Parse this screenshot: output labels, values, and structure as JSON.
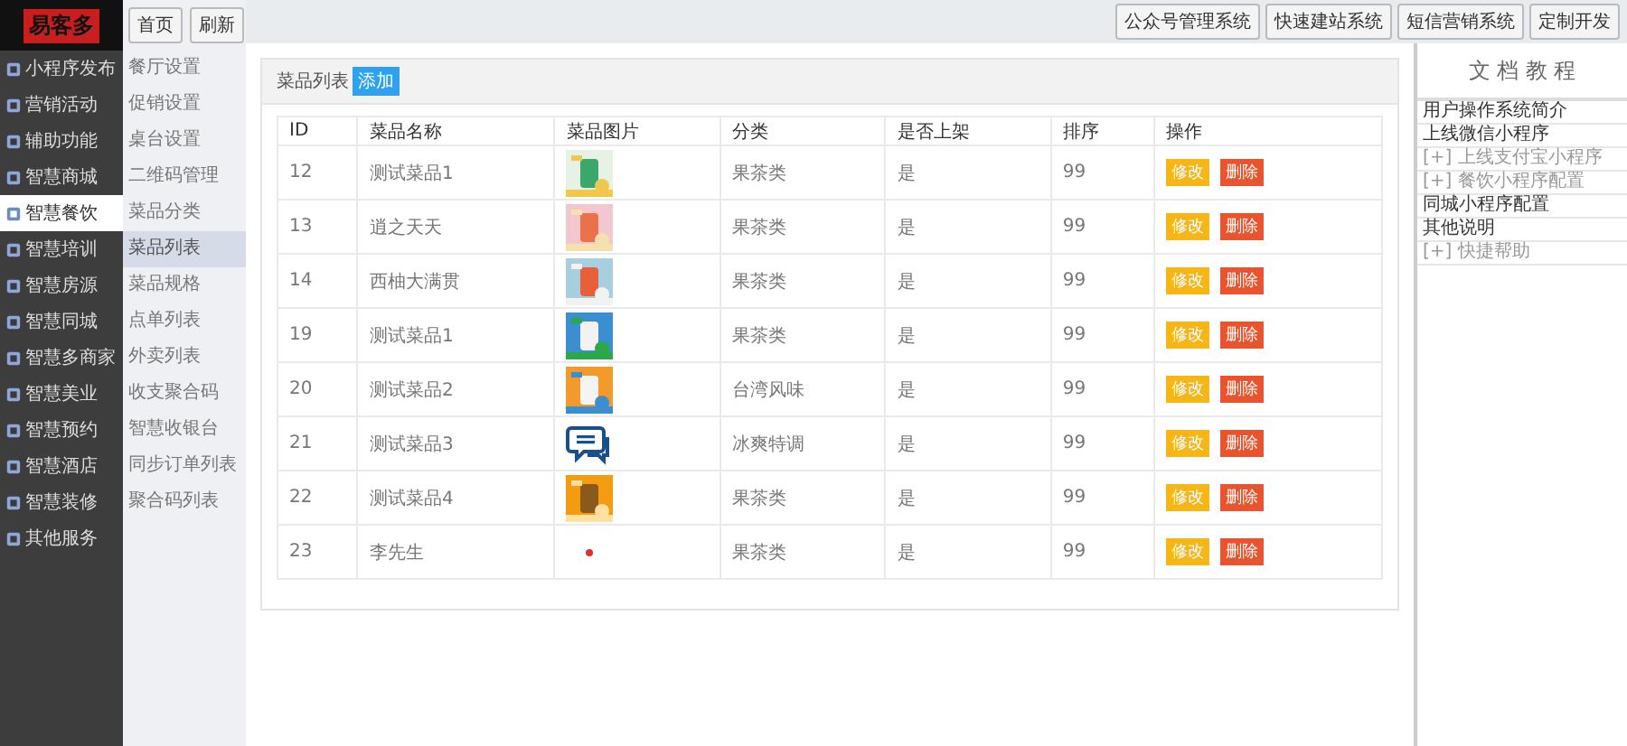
{
  "logo": "易客多",
  "top_buttons": [
    "首页",
    "刷新"
  ],
  "top_links": [
    "公众号管理系统",
    "快速建站系统",
    "短信营销系统",
    "定制开发"
  ],
  "sidebar": {
    "items": [
      {
        "label": "小程序发布",
        "selected": false
      },
      {
        "label": "营销活动",
        "selected": false
      },
      {
        "label": "辅助功能",
        "selected": false
      },
      {
        "label": "智慧商城",
        "selected": false
      },
      {
        "label": "智慧餐饮",
        "selected": true
      },
      {
        "label": "智慧培训",
        "selected": false
      },
      {
        "label": "智慧房源",
        "selected": false
      },
      {
        "label": "智慧同城",
        "selected": false
      },
      {
        "label": "智慧多商家",
        "selected": false
      },
      {
        "label": "智慧美业",
        "selected": false
      },
      {
        "label": "智慧预约",
        "selected": false
      },
      {
        "label": "智慧酒店",
        "selected": false
      },
      {
        "label": "智慧装修",
        "selected": false
      },
      {
        "label": "其他服务",
        "selected": false
      }
    ]
  },
  "submenu": {
    "items": [
      {
        "label": "餐厅设置",
        "selected": false
      },
      {
        "label": "促销设置",
        "selected": false
      },
      {
        "label": "桌台设置",
        "selected": false
      },
      {
        "label": "二维码管理",
        "selected": false
      },
      {
        "label": "菜品分类",
        "selected": false
      },
      {
        "label": "菜品列表",
        "selected": true
      },
      {
        "label": "菜品规格",
        "selected": false
      },
      {
        "label": "点单列表",
        "selected": false
      },
      {
        "label": "外卖列表",
        "selected": false
      },
      {
        "label": "收支聚合码",
        "selected": false
      },
      {
        "label": "智慧收银台",
        "selected": false
      },
      {
        "label": "同步订单列表",
        "selected": false
      },
      {
        "label": "聚合码列表",
        "selected": false
      }
    ]
  },
  "panel": {
    "title": "菜品列表",
    "add_button": "添加"
  },
  "table": {
    "columns": [
      "ID",
      "菜品名称",
      "菜品图片",
      "分类",
      "是否上架",
      "排序",
      "操作"
    ],
    "rows": [
      {
        "id": "12",
        "name": "测试菜品1",
        "category": "果茶类",
        "on_shelf": "是",
        "sort": "99",
        "edit": "修改",
        "delete": "删除"
      },
      {
        "id": "13",
        "name": "逍之天天",
        "category": "果茶类",
        "on_shelf": "是",
        "sort": "99",
        "edit": "修改",
        "delete": "删除"
      },
      {
        "id": "14",
        "name": "西柚大满贯",
        "category": "果茶类",
        "on_shelf": "是",
        "sort": "99",
        "edit": "修改",
        "delete": "删除"
      },
      {
        "id": "19",
        "name": "测试菜品1",
        "category": "果茶类",
        "on_shelf": "是",
        "sort": "99",
        "edit": "修改",
        "delete": "删除"
      },
      {
        "id": "20",
        "name": "测试菜品2",
        "category": "台湾风味",
        "on_shelf": "是",
        "sort": "99",
        "edit": "修改",
        "delete": "删除"
      },
      {
        "id": "21",
        "name": "测试菜品3",
        "image": {
          "kind": "chat"
        },
        "category": "冰爽特调",
        "on_shelf": "是",
        "sort": "99",
        "edit": "修改",
        "delete": "删除"
      },
      {
        "id": "22",
        "name": "测试菜品4",
        "category": "果茶类",
        "on_shelf": "是",
        "sort": "99",
        "edit": "修改",
        "delete": "删除"
      },
      {
        "id": "23",
        "name": "李先生",
        "image": {
          "kind": "dot"
        },
        "category": "果茶类",
        "on_shelf": "是",
        "sort": "99",
        "edit": "修改",
        "delete": "删除"
      }
    ]
  },
  "docs": {
    "title": "文 档 教 程",
    "items": [
      {
        "label": "用户操作系统简介",
        "expandable": false
      },
      {
        "label": "上线微信小程序",
        "expandable": false
      },
      {
        "label": "[+] 上线支付宝小程序",
        "expandable": true
      },
      {
        "label": "[+] 餐饮小程序配置",
        "expandable": true
      },
      {
        "label": "同城小程序配置",
        "expandable": false
      },
      {
        "label": "其他说明",
        "expandable": false
      },
      {
        "label": "[+] 快捷帮助",
        "expandable": true
      }
    ]
  }
}
